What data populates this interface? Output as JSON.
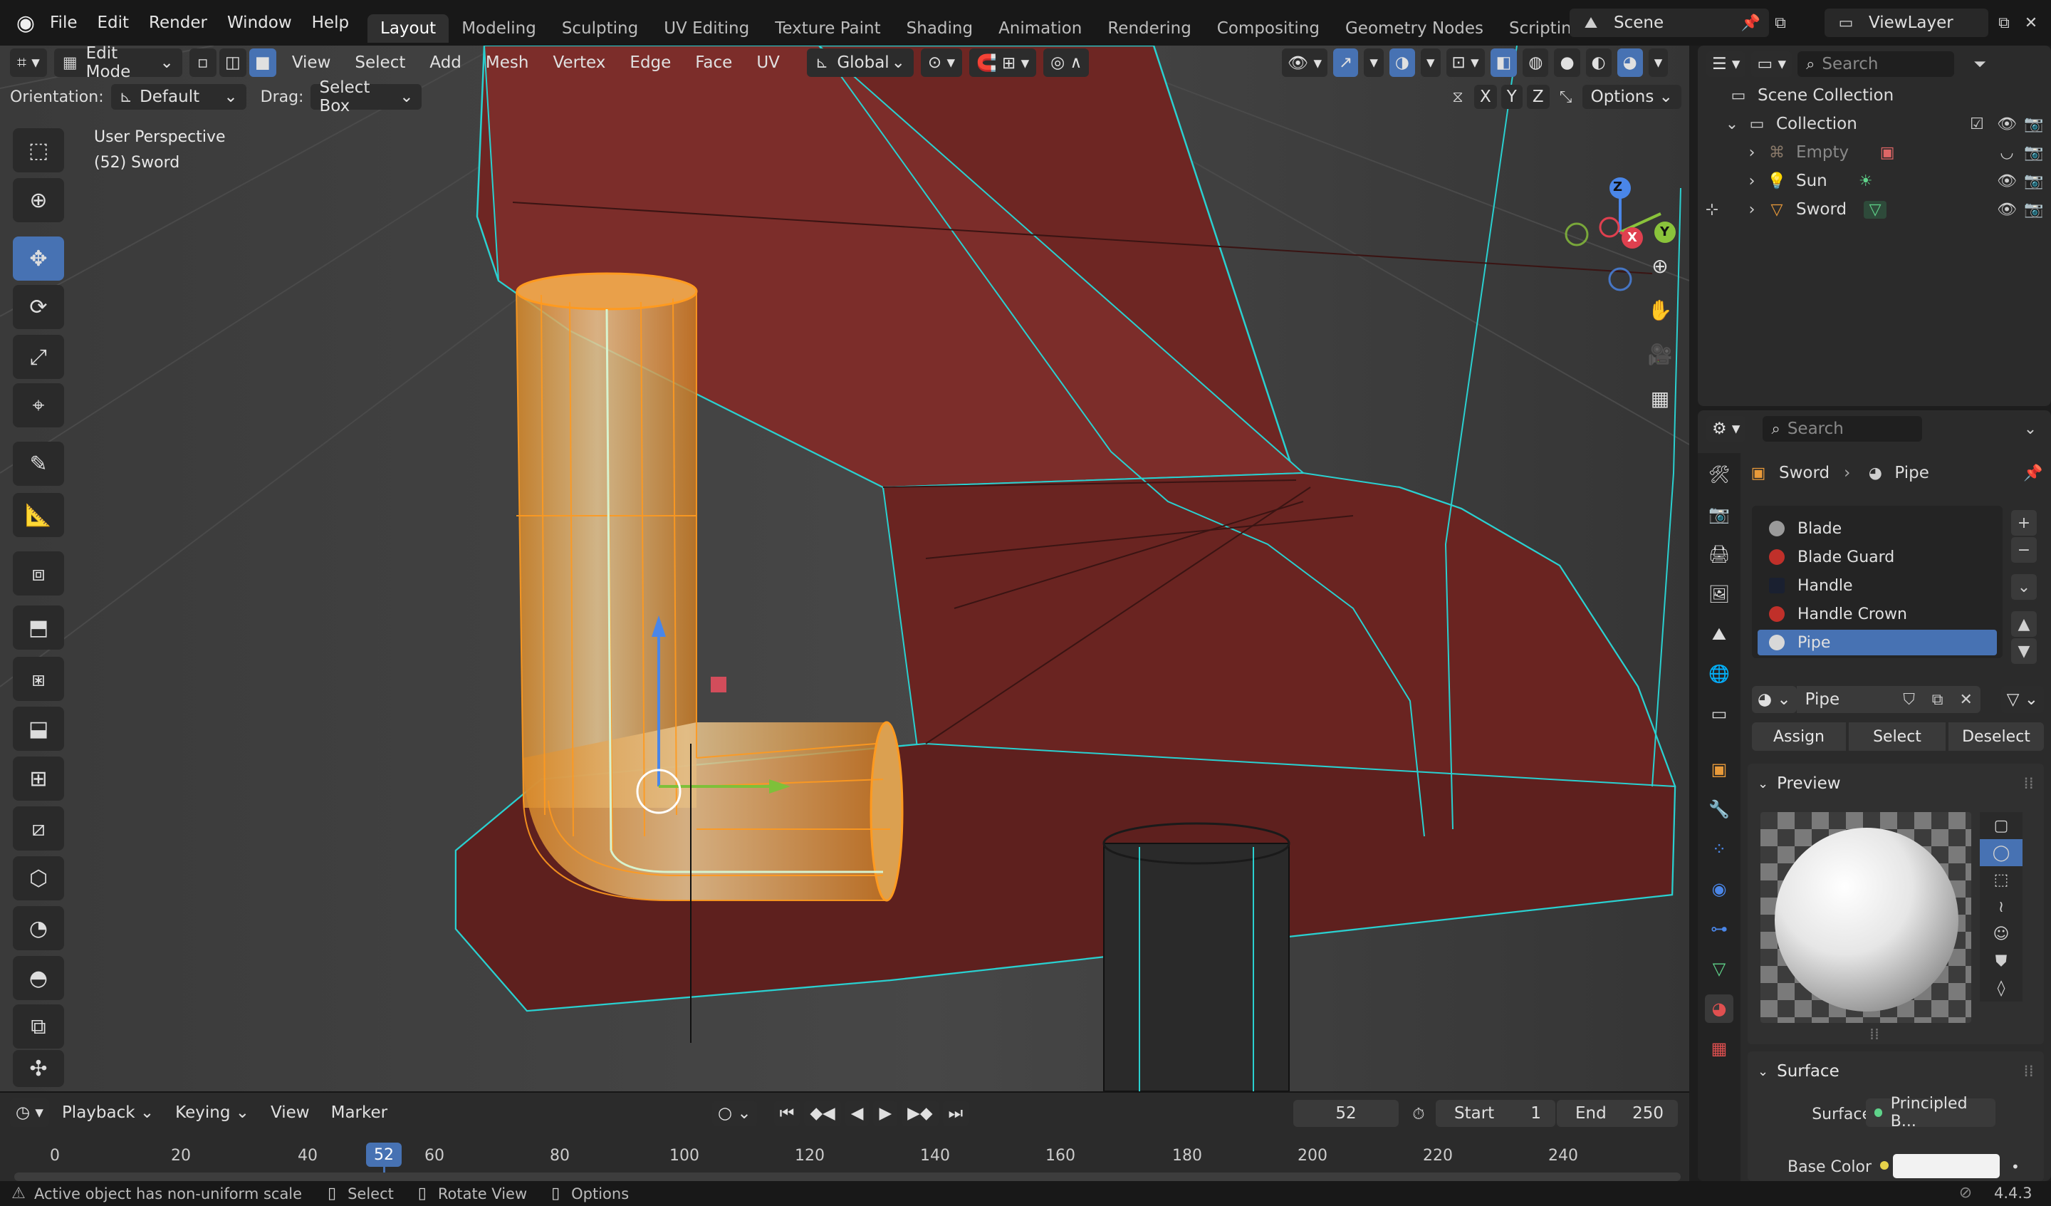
{
  "menu": {
    "file": "File",
    "edit": "Edit",
    "render": "Render",
    "window": "Window",
    "help": "Help"
  },
  "workspaces": [
    "Layout",
    "Modeling",
    "Sculpting",
    "UV Editing",
    "Texture Paint",
    "Shading",
    "Animation",
    "Rendering",
    "Compositing",
    "Geometry Nodes",
    "Scripting"
  ],
  "scene": {
    "name": "Scene",
    "view_layer": "ViewLayer"
  },
  "viewport_header": {
    "mode": "Edit Mode",
    "view": "View",
    "select": "Select",
    "add": "Add",
    "mesh": "Mesh",
    "vertex": "Vertex",
    "edge": "Edge",
    "face": "Face",
    "uv": "UV",
    "transform_orientation": "Global"
  },
  "tool_settings": {
    "orientation_label": "Orientation:",
    "orientation_value": "Default",
    "drag_label": "Drag:",
    "drag_value": "Select Box",
    "options": "Options",
    "axes": [
      "X",
      "Y",
      "Z"
    ]
  },
  "viewport_overlay": {
    "perspective": "User Perspective",
    "object_info": "(52) Sword"
  },
  "gizmo": {
    "x": "X",
    "y": "Y",
    "z": "Z"
  },
  "timeline": {
    "playback": "Playback",
    "keying": "Keying",
    "view": "View",
    "marker": "Marker",
    "current_frame": "52",
    "start_label": "Start",
    "start": "1",
    "end_label": "End",
    "end": "250",
    "ticks": [
      "0",
      "20",
      "40",
      "60",
      "80",
      "100",
      "120",
      "140",
      "160",
      "180",
      "200",
      "220",
      "240"
    ],
    "playhead_label": "52"
  },
  "outliner": {
    "search_placeholder": "Search",
    "scene_collection": "Scene Collection",
    "collection": "Collection",
    "items": [
      "Empty",
      "Sun",
      "Sword"
    ]
  },
  "properties": {
    "search_placeholder": "Search",
    "breadcrumb_object": "Sword",
    "breadcrumb_material": "Pipe",
    "materials": [
      {
        "name": "Blade",
        "color": "#9a9a9a"
      },
      {
        "name": "Blade Guard",
        "color": "#c0302a"
      },
      {
        "name": "Handle",
        "color": "#1a2030"
      },
      {
        "name": "Handle Crown",
        "color": "#c0302a"
      },
      {
        "name": "Pipe",
        "color": "#d8d8d8"
      }
    ],
    "material_field": "Pipe",
    "assign": "Assign",
    "select": "Select",
    "deselect": "Deselect",
    "preview_header": "Preview",
    "surface_header": "Surface",
    "surface_label": "Surface",
    "surface_value": "Principled B...",
    "base_color_label": "Base Color",
    "base_color": "#f2f2f2"
  },
  "status": {
    "message": "Active object has non-uniform scale",
    "select": "Select",
    "rotate": "Rotate View",
    "options": "Options",
    "version": "4.4.3"
  },
  "colors": {
    "accent": "#4772b3",
    "selection": "#ff9a1f",
    "mesh": "#6e2623",
    "wire": "#2ad0d0"
  }
}
